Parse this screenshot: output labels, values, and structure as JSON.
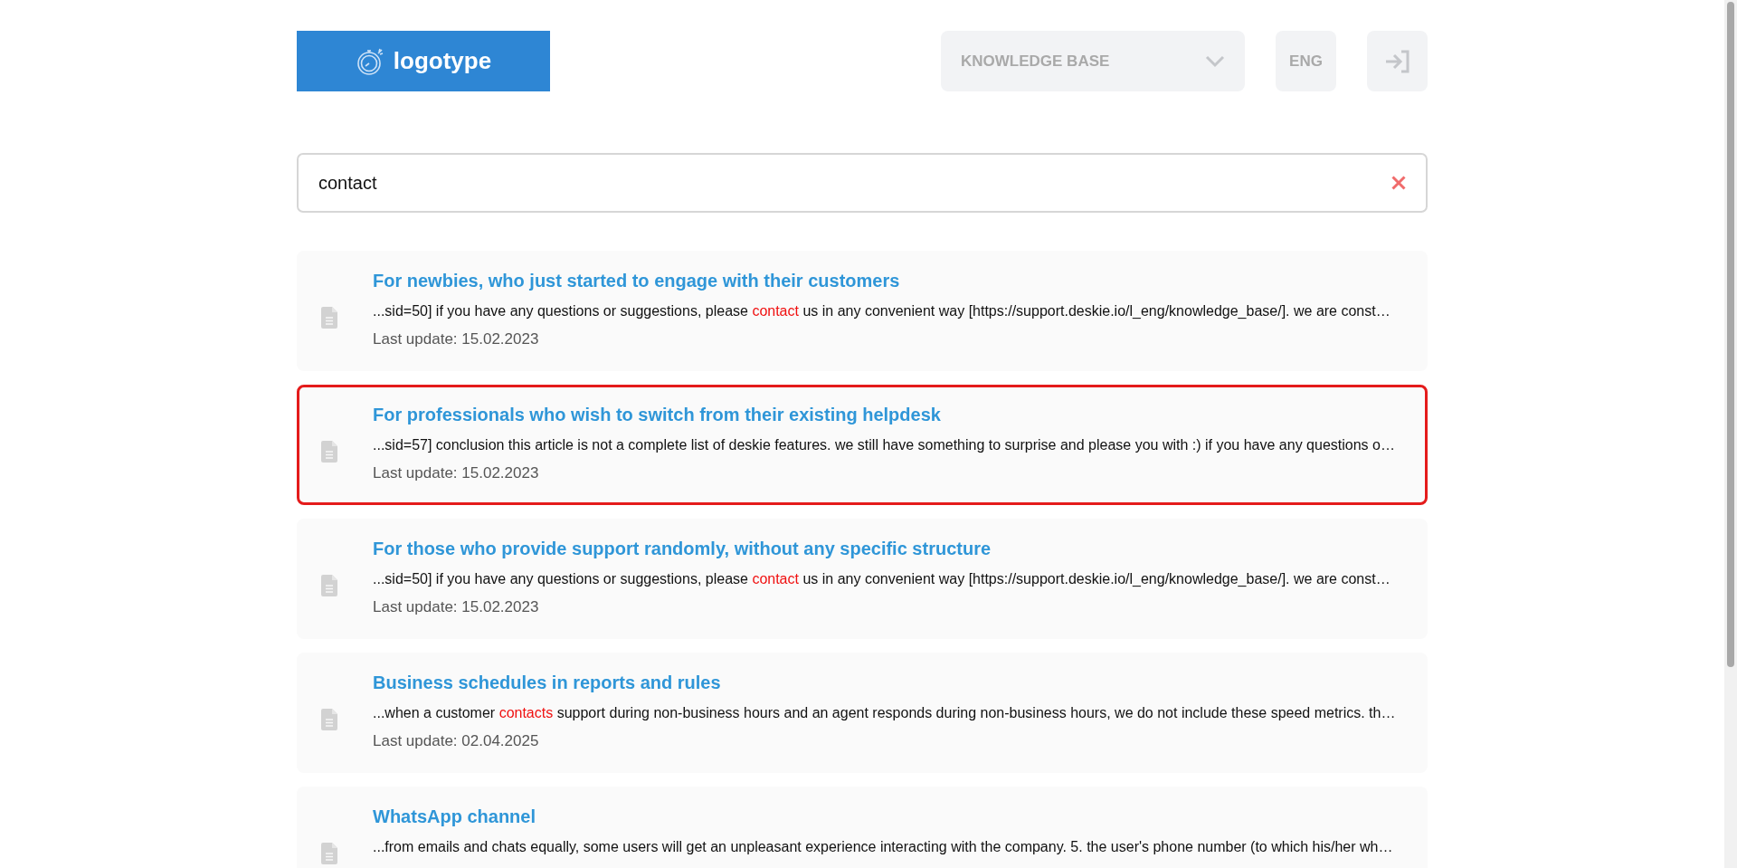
{
  "header": {
    "logo": "logotype",
    "section_dropdown": "KNOWLEDGE BASE",
    "language": "ENG"
  },
  "search": {
    "value": "contact"
  },
  "results": [
    {
      "title": "For newbies, who just started to engage with their customers",
      "snippet": {
        "before": "...sid=50] if you have any questions or suggestions, please ",
        "match": "contact",
        "after": " us in any convenient way [https://support.deskie.io/l_eng/knowledge_base/]. we are const…"
      },
      "updated": "Last update: 15.02.2023",
      "selected": false
    },
    {
      "title": "For professionals who wish to switch from their existing helpdesk",
      "snippet": {
        "before": "...sid=57] conclusion this article is not a complete list of deskie features. we still have something to surprise and please you with :) if you have any questions o…"
      },
      "updated": "Last update: 15.02.2023",
      "selected": true
    },
    {
      "title": "For those who provide support randomly, without any specific structure",
      "snippet": {
        "before": "...sid=50] if you have any questions or suggestions, please ",
        "match": "contact",
        "after": " us in any convenient way [https://support.deskie.io/l_eng/knowledge_base/]. we are const…"
      },
      "updated": "Last update: 15.02.2023",
      "selected": false
    },
    {
      "title": "Business schedules in reports and rules",
      "snippet": {
        "before": "...when a customer ",
        "match": "contacts",
        "after": " support during non-business hours and an agent responds during non-business hours, we do not include these speed metrics. th…"
      },
      "updated": "Last update: 02.04.2025",
      "selected": false
    },
    {
      "title": "WhatsApp channel",
      "snippet": {
        "before": "...from emails and chats equally, some users will get an unpleasant experience interacting with the company. 5. the user's phone number (to which his/her wh…"
      },
      "selected": false
    }
  ]
}
